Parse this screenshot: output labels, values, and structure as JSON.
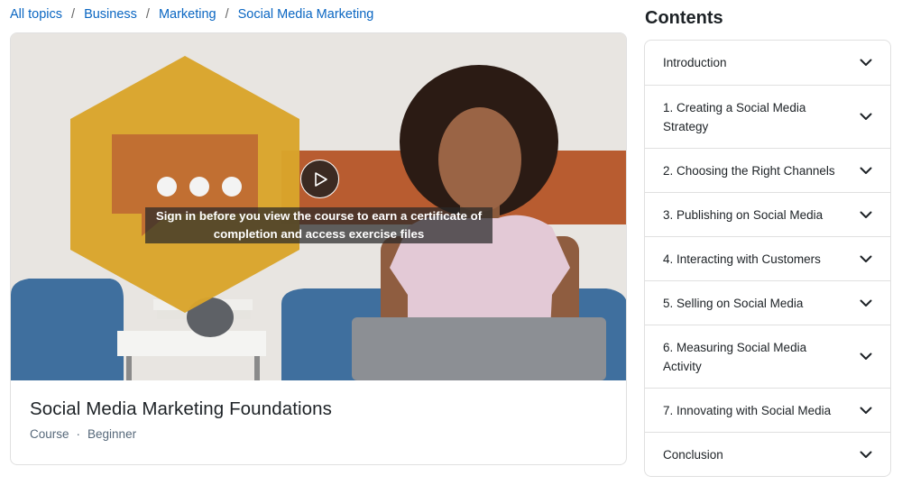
{
  "breadcrumb": [
    {
      "label": "All topics"
    },
    {
      "label": "Business"
    },
    {
      "label": "Marketing"
    },
    {
      "label": "Social Media Marketing"
    }
  ],
  "breadcrumb_separator": "/",
  "video": {
    "overlay_message": "Sign in before you view the course to earn a certificate of completion and access exercise files",
    "play_icon": "play-icon"
  },
  "course": {
    "title": "Social Media Marketing Foundations",
    "type": "Course",
    "separator": "·",
    "level": "Beginner"
  },
  "contents": {
    "title": "Contents",
    "items": [
      {
        "label": "Introduction"
      },
      {
        "label": "1. Creating a Social Media Strategy"
      },
      {
        "label": "2. Choosing the Right Channels"
      },
      {
        "label": "3. Publishing on Social Media"
      },
      {
        "label": "4. Interacting with Customers"
      },
      {
        "label": "5. Selling on Social Media"
      },
      {
        "label": "6. Measuring Social Media Activity"
      },
      {
        "label": "7. Innovating with Social Media"
      },
      {
        "label": "Conclusion"
      }
    ],
    "expand_icon": "chevron-down-icon"
  },
  "colors": {
    "link": "#0a66c2",
    "hexagon": "#d9a42b",
    "stripe": "#b85c30"
  }
}
